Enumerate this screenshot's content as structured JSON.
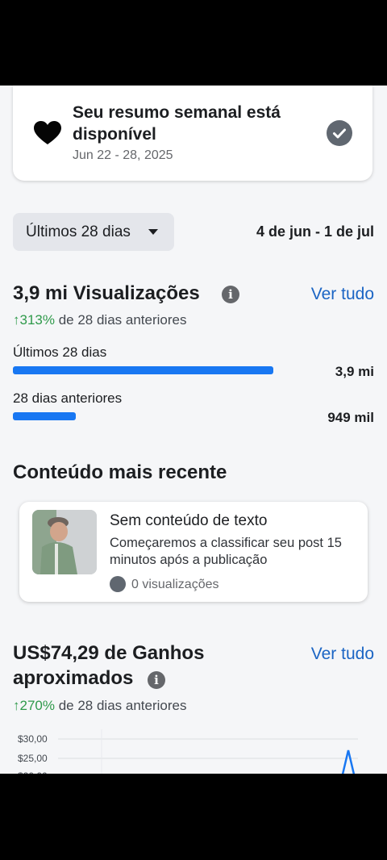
{
  "weekly_summary": {
    "title": "Seu resumo semanal está disponível",
    "date_range": "Jun 22 - 28, 2025"
  },
  "period": {
    "selector_label": "Últimos 28 dias",
    "range": "4 de jun - 1 de jul"
  },
  "views": {
    "title": "3,9 mi Visualizações",
    "see_all": "Ver tudo",
    "growth_pct": "↑313%",
    "growth_text": " de 28 dias anteriores",
    "rows": [
      {
        "label": "Últimos 28 dias",
        "value": "3,9 mi",
        "fraction": 1.0
      },
      {
        "label": "28 dias anteriores",
        "value": "949 mil",
        "fraction": 0.243
      }
    ]
  },
  "recent_content": {
    "section_title": "Conteúdo mais recente",
    "item": {
      "title": "Sem conteúdo de texto",
      "description": "Começaremos a classificar seu post 15 minutos após a publicação",
      "views": "0 visualizações"
    }
  },
  "earnings": {
    "title": "US$74,29 de Ganhos aproximados",
    "see_all": "Ver tudo",
    "growth_pct": "↑270%",
    "growth_text": " de 28 dias anteriores"
  },
  "chart_data": {
    "type": "line",
    "ytick_labels": [
      "$30,00",
      "$25,00"
    ],
    "grid": true
  },
  "colors": {
    "accent": "#1877f2",
    "link": "#1b65c4",
    "positive": "#2f9a4b"
  }
}
